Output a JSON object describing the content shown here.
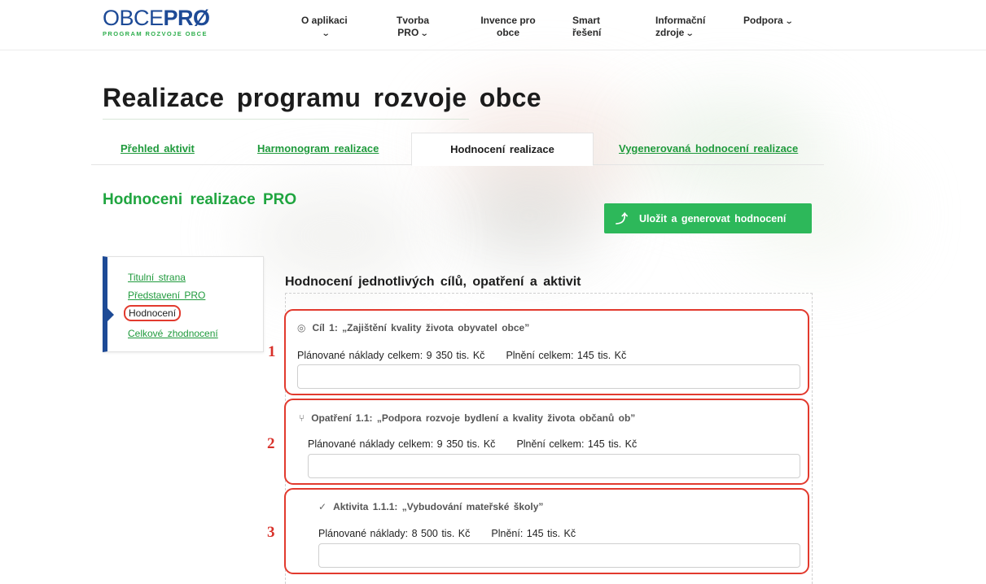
{
  "logo": {
    "main_left": "OBCE",
    "main_right": "PRØ",
    "subtitle": "PROGRAM ROZVOJE OBCE"
  },
  "nav": [
    {
      "label": "O aplikaci",
      "has_dropdown": true
    },
    {
      "label": "Tvorba PRO",
      "has_dropdown": true
    },
    {
      "label": "Invence pro obce",
      "has_dropdown": false
    },
    {
      "label": "Smart řešení",
      "has_dropdown": false
    },
    {
      "label": "Informační zdroje",
      "has_dropdown": true
    },
    {
      "label": "Podpora",
      "has_dropdown": true
    }
  ],
  "page": {
    "title": "Realizace programu rozvoje obce",
    "tabs": [
      {
        "label": "Přehled aktivit",
        "active": false
      },
      {
        "label": "Harmonogram realizace",
        "active": false
      },
      {
        "label": "Hodnocení realizace",
        "active": true
      },
      {
        "label": "Vygenerovaná hodnocení realizace",
        "active": false
      }
    ],
    "section_title": "Hodnoceni realizace PRO",
    "save_button": "Uložit a generovat hodnocení"
  },
  "sidemenu": {
    "items": [
      "Titulní strana",
      "Představení PRO",
      "Hodnocení",
      "Celkové zhodnocení"
    ],
    "active_index": 2
  },
  "evaluation": {
    "heading": "Hodnocení jednotlivých cílů, opatření a aktivit",
    "cards": [
      {
        "marker": "1",
        "icon": "target-icon",
        "title": "Cíl 1: „Zajištění kvality života obyvatel obce”",
        "planned": "Plánované náklady celkem: 9 350 tis. Kč",
        "fulfilled": "Plnění celkem: 145 tis. Kč",
        "input_value": ""
      },
      {
        "marker": "2",
        "icon": "branch-icon",
        "title": "Opatření 1.1: „Podpora rozvoje bydlení a kvality života občanů ob”",
        "planned": "Plánované náklady celkem: 9 350 tis. Kč",
        "fulfilled": "Plnění celkem: 145 tis. Kč",
        "input_value": ""
      },
      {
        "marker": "3",
        "icon": "check-circle-icon",
        "title": "Aktivita 1.1.1: „Vybudování mateřské školy”",
        "planned": "Plánované náklady: 8 500 tis. Kč",
        "fulfilled": "Plnění: 145 tis. Kč",
        "input_value": ""
      }
    ]
  },
  "colors": {
    "brand_blue": "#1d4a96",
    "brand_green": "#2eae4d",
    "button_green": "#2db85a",
    "annotation_red": "#e23a2e"
  }
}
